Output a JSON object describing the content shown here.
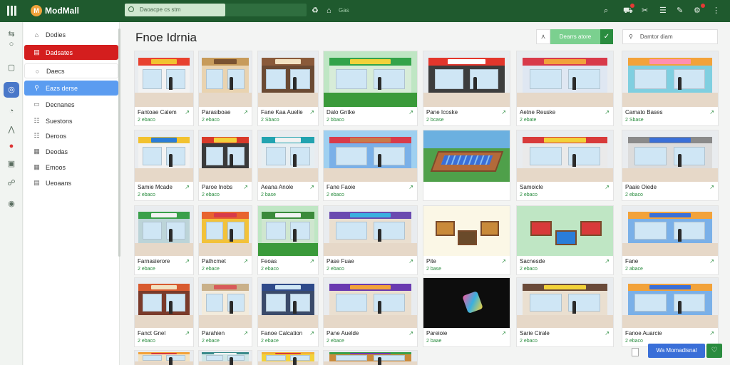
{
  "app": {
    "name": "ModMall",
    "logo_letter": "M",
    "search_text": "Daoacpe cs stm",
    "top_tag": "Gas"
  },
  "page": {
    "title": "Fnoe Idrnia",
    "header_button_label": "Dearrs atore",
    "header_search_label": "Damtor diam",
    "fab_label": "Wa Momadisnal"
  },
  "sidebar": {
    "items": [
      {
        "label": "Dodies",
        "icon": "home-icon",
        "style": "plain"
      },
      {
        "label": "Dadsates",
        "icon": "store-icon",
        "style": "red"
      },
      {
        "label": "Daecs",
        "icon": "search-icon",
        "style": "sel"
      },
      {
        "label": "Eazs derse",
        "icon": "tag-icon",
        "style": "blue"
      },
      {
        "label": "Decnanes",
        "icon": "chat-icon",
        "style": "plain"
      },
      {
        "label": "Suestons",
        "icon": "list-icon",
        "style": "plain"
      },
      {
        "label": "Deroos",
        "icon": "list-icon",
        "style": "plain"
      },
      {
        "label": "Deodas",
        "icon": "doc-icon",
        "style": "plain"
      },
      {
        "label": "Emoos",
        "icon": "doc-icon",
        "style": "plain"
      },
      {
        "label": "Ueoaans",
        "icon": "stack-icon",
        "style": "plain"
      }
    ]
  },
  "cards": [
    {
      "caption": "Fantoae Calem",
      "sub": "2 ebaco",
      "theme": "store",
      "awning": "#e8412f",
      "wall": "#f2f2f2",
      "accent": "#f2c230"
    },
    {
      "caption": "Parasiboae",
      "sub": "2 ebaco",
      "theme": "store",
      "awning": "#c79b5b",
      "wall": "#e9d3b0",
      "accent": "#7a5230"
    },
    {
      "caption": "Fane Kaa Auelle",
      "sub": "2 Sbaco",
      "theme": "store",
      "awning": "#8a5a3a",
      "wall": "#6b4a33",
      "accent": "#f3e2c2"
    },
    {
      "caption": "Dalo Gntke",
      "sub": "2 bbaco",
      "theme": "green",
      "awning": "#33a34a",
      "wall": "#d7ecd8",
      "accent": "#f2d23a"
    },
    {
      "caption": "Pane Icoske",
      "sub": "2 bcase",
      "theme": "store",
      "awning": "#e2362c",
      "wall": "#3d3d3d",
      "accent": "#ffffff"
    },
    {
      "caption": "Aetne Reuske",
      "sub": "2 ebate",
      "theme": "store",
      "awning": "#d83a4a",
      "wall": "#dfe7f2",
      "accent": "#f2a23a"
    },
    {
      "caption": "Camato Bases",
      "sub": "2 Sbase",
      "theme": "store",
      "awning": "#f2a23a",
      "wall": "#7fcfe0",
      "accent": "#ff8fb0"
    },
    {
      "caption": "Samie Mcade",
      "sub": "2 ebaco",
      "theme": "store",
      "awning": "#f2c230",
      "wall": "#f2f2f2",
      "accent": "#2a7dd8"
    },
    {
      "caption": "Paroe Inobs",
      "sub": "2 ebaco",
      "theme": "store",
      "awning": "#d93a2a",
      "wall": "#3a3a3a",
      "accent": "#f2d23a"
    },
    {
      "caption": "Aeana Anole",
      "sub": "2 base",
      "theme": "store",
      "awning": "#22a3b0",
      "wall": "#e6eef2",
      "accent": "#f2f2f2"
    },
    {
      "caption": "Fane Faoie",
      "sub": "2 ebaco",
      "theme": "outdoor",
      "awning": "#d83a4a",
      "wall": "#7ab0e8",
      "accent": "#c97a4a"
    },
    {
      "caption": "",
      "sub": "",
      "theme": "aerial",
      "awning": "#b36a3a",
      "wall": "#6bb0e0",
      "accent": "#4fa04a"
    },
    {
      "caption": "Samoicle",
      "sub": "2 ebaco",
      "theme": "store",
      "awning": "#d83a3a",
      "wall": "#eaeaea",
      "accent": "#f2d23a"
    },
    {
      "caption": "Paaie Oiede",
      "sub": "2 ebaco",
      "theme": "store",
      "awning": "#8a8a8a",
      "wall": "#dcdcdc",
      "accent": "#3a6fd8"
    },
    {
      "caption": "Farnasierore",
      "sub": "2 ebace",
      "theme": "store",
      "awning": "#3aa04a",
      "wall": "#bcd4d8",
      "accent": "#f2f2f2"
    },
    {
      "caption": "Pathcmet",
      "sub": "2 ebace",
      "theme": "store",
      "awning": "#e8632f",
      "wall": "#f2c23a",
      "accent": "#d83a4a"
    },
    {
      "caption": "Feoas",
      "sub": "2 ebaco",
      "theme": "green",
      "awning": "#3a8a3a",
      "wall": "#cfe6cf",
      "accent": "#f2f2f2"
    },
    {
      "caption": "Pase Fuae",
      "sub": "2 ebaco",
      "theme": "store",
      "awning": "#6a4ab0",
      "wall": "#eadfd0",
      "accent": "#3ab0e0"
    },
    {
      "caption": "Pite",
      "sub": "2 base",
      "theme": "market",
      "awning": "#c98a3a",
      "wall": "#fbf7e6",
      "accent": "#6a4a2a"
    },
    {
      "caption": "Sacnesde",
      "sub": "2 ebaco",
      "theme": "market",
      "awning": "#d83a3a",
      "wall": "#bfe6c4",
      "accent": "#2a7dd8"
    },
    {
      "caption": "Fane",
      "sub": "2 abace",
      "theme": "store",
      "awning": "#f2a23a",
      "wall": "#7ab0e8",
      "accent": "#3a6fd8"
    },
    {
      "caption": "Fanct Gnel",
      "sub": "2 ebaco",
      "theme": "store",
      "awning": "#d85a2f",
      "wall": "#7a3a2a",
      "accent": "#f2e2c2"
    },
    {
      "caption": "Parahien",
      "sub": "2 ebace",
      "theme": "store",
      "awning": "#c9b08a",
      "wall": "#f2ebdc",
      "accent": "#d85a5a"
    },
    {
      "caption": "Fanoe Calcation",
      "sub": "2 ebace",
      "theme": "store",
      "awning": "#2f4a8a",
      "wall": "#3a4a6a",
      "accent": "#cfe6f5"
    },
    {
      "caption": "Pane Auelde",
      "sub": "2 ebace",
      "theme": "store",
      "awning": "#6a3ab0",
      "wall": "#eadfd0",
      "accent": "#f2a23a"
    },
    {
      "caption": "Pareioie",
      "sub": "2 baae",
      "theme": "dark",
      "awning": "#111111",
      "wall": "#111111",
      "accent": "#3ab0e0"
    },
    {
      "caption": "Sarie Cirale",
      "sub": "2 ebaco",
      "theme": "store",
      "awning": "#6a4a3a",
      "wall": "#eadfd0",
      "accent": "#f2d23a"
    },
    {
      "caption": "Fanoe Auarcie",
      "sub": "2 ebaco",
      "theme": "store",
      "awning": "#f2a23a",
      "wall": "#7ab0e8",
      "accent": "#3a6fd8"
    },
    {
      "caption": "",
      "sub": "",
      "theme": "store",
      "awning": "#f2a23a",
      "wall": "#f2e2c2",
      "accent": "#d83a3a"
    },
    {
      "caption": "",
      "sub": "",
      "theme": "store",
      "awning": "#3a8a8a",
      "wall": "#cfe6e6",
      "accent": "#f2f2f2"
    },
    {
      "caption": "",
      "sub": "",
      "theme": "store",
      "awning": "#f2b23a",
      "wall": "#f2d23a",
      "accent": "#d83a3a"
    },
    {
      "caption": "",
      "sub": "",
      "theme": "store",
      "awning": "#3aa04a",
      "wall": "#c98a3a",
      "accent": "#6a3ab0"
    }
  ]
}
